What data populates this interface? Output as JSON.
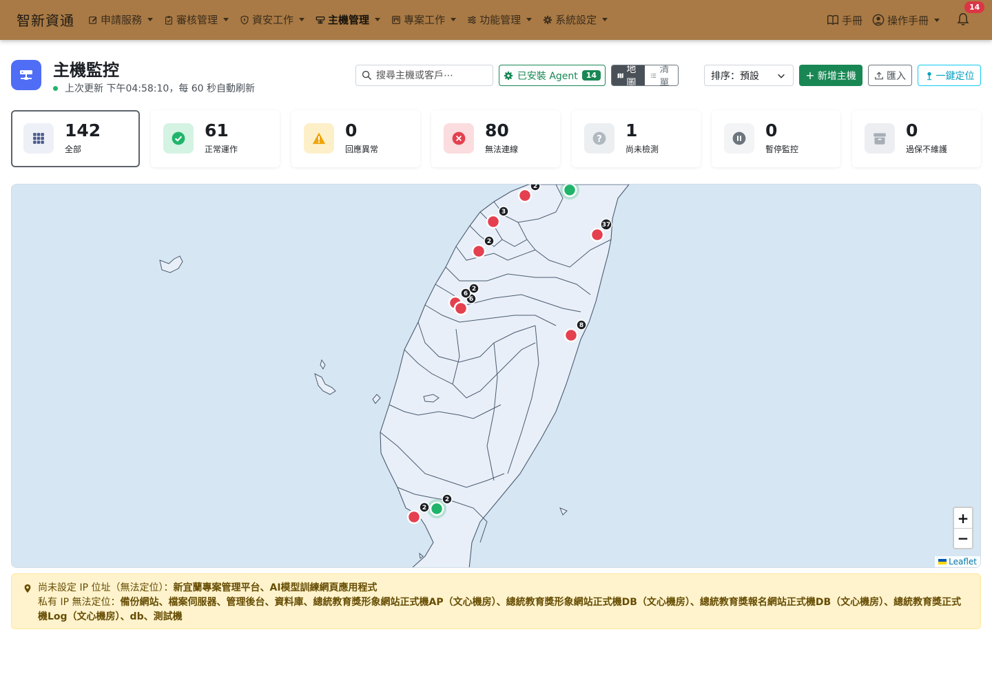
{
  "app": {
    "brand": "智新資通"
  },
  "nav": {
    "items": [
      {
        "label": "申請服務",
        "icon": "pencil-square-icon"
      },
      {
        "label": "審核管理",
        "icon": "clipboard-check-icon"
      },
      {
        "label": "資安工作",
        "icon": "shield-icon"
      },
      {
        "label": "主機管理",
        "icon": "server-icon",
        "active": true
      },
      {
        "label": "專案工作",
        "icon": "kanban-icon"
      },
      {
        "label": "功能管理",
        "icon": "sliders-icon"
      },
      {
        "label": "系統設定",
        "icon": "gear-icon"
      }
    ],
    "manual": "手冊",
    "user_menu": "操作手冊",
    "notification_count": "14"
  },
  "header": {
    "title": "主機監控",
    "last_update": "上次更新 下午04:58:10，每 60 秒自動刷新"
  },
  "toolbar": {
    "search_placeholder": "搜尋主機或客戶⋯",
    "agent_label": "已安裝 Agent",
    "agent_count": "14",
    "view_map": "地圖",
    "view_list": "清單",
    "sort_label": "排序：預設",
    "add_label": "新增主機",
    "import_label": "匯入",
    "locate_label": "一鍵定位"
  },
  "stats": [
    {
      "value": "142",
      "label": "全部",
      "icon": "grid-icon",
      "bg": "#eef0f7",
      "fg": "#4a5a8a"
    },
    {
      "value": "61",
      "label": "正常運作",
      "icon": "check-circle-icon",
      "bg": "#d4f3e3",
      "fg": "#20b46a"
    },
    {
      "value": "0",
      "label": "回應異常",
      "icon": "warning-triangle-icon",
      "bg": "#fdf0c8",
      "fg": "#f0a30a"
    },
    {
      "value": "80",
      "label": "無法連線",
      "icon": "x-circle-icon",
      "bg": "#fbdcdf",
      "fg": "#e4404f"
    },
    {
      "value": "1",
      "label": "尚未檢測",
      "icon": "question-circle-icon",
      "bg": "#eceff2",
      "fg": "#b0b8c0"
    },
    {
      "value": "0",
      "label": "暫停監控",
      "icon": "pause-circle-icon",
      "bg": "#f3f4f6",
      "fg": "#6c757d"
    },
    {
      "value": "0",
      "label": "過保不維護",
      "icon": "archive-icon",
      "bg": "#eceef1",
      "fg": "#a7aeb6"
    }
  ],
  "map": {
    "markers": [
      {
        "status": "down",
        "count": "2"
      },
      {
        "status": "up",
        "count": ""
      },
      {
        "status": "down",
        "count": "3"
      },
      {
        "status": "down",
        "count": "37"
      },
      {
        "status": "down",
        "count": "2"
      },
      {
        "status": "down",
        "count": "2"
      },
      {
        "status": "down",
        "count": "6"
      },
      {
        "status": "down",
        "count": "6"
      },
      {
        "status": "down",
        "count": "8"
      },
      {
        "status": "up",
        "count": "2"
      },
      {
        "status": "down",
        "count": "2"
      }
    ],
    "zoom_in": "+",
    "zoom_out": "−",
    "attribution": "Leaflet"
  },
  "notice": {
    "line1_label": "尚未設定 IP 位址（無法定位）：",
    "line1_items": "新宜蘭專案管理平台、AI模型訓練網頁應用程式",
    "line2_label": "私有 IP 無法定位：",
    "line2_items": "備份網站、檔案伺服器、管理後台、資料庫、總統教育獎形象網站正式機AP（文心機房）、總統教育獎形象網站正式機DB（文心機房）、總統教育獎報名網站正式機DB（文心機房）、總統教育獎正式機Log（文心機房）、db、測試機"
  },
  "colors": {
    "nav_bg": "#a97a45",
    "down": "#e4404f",
    "up": "#20b46a",
    "primary": "#4f6df5"
  }
}
